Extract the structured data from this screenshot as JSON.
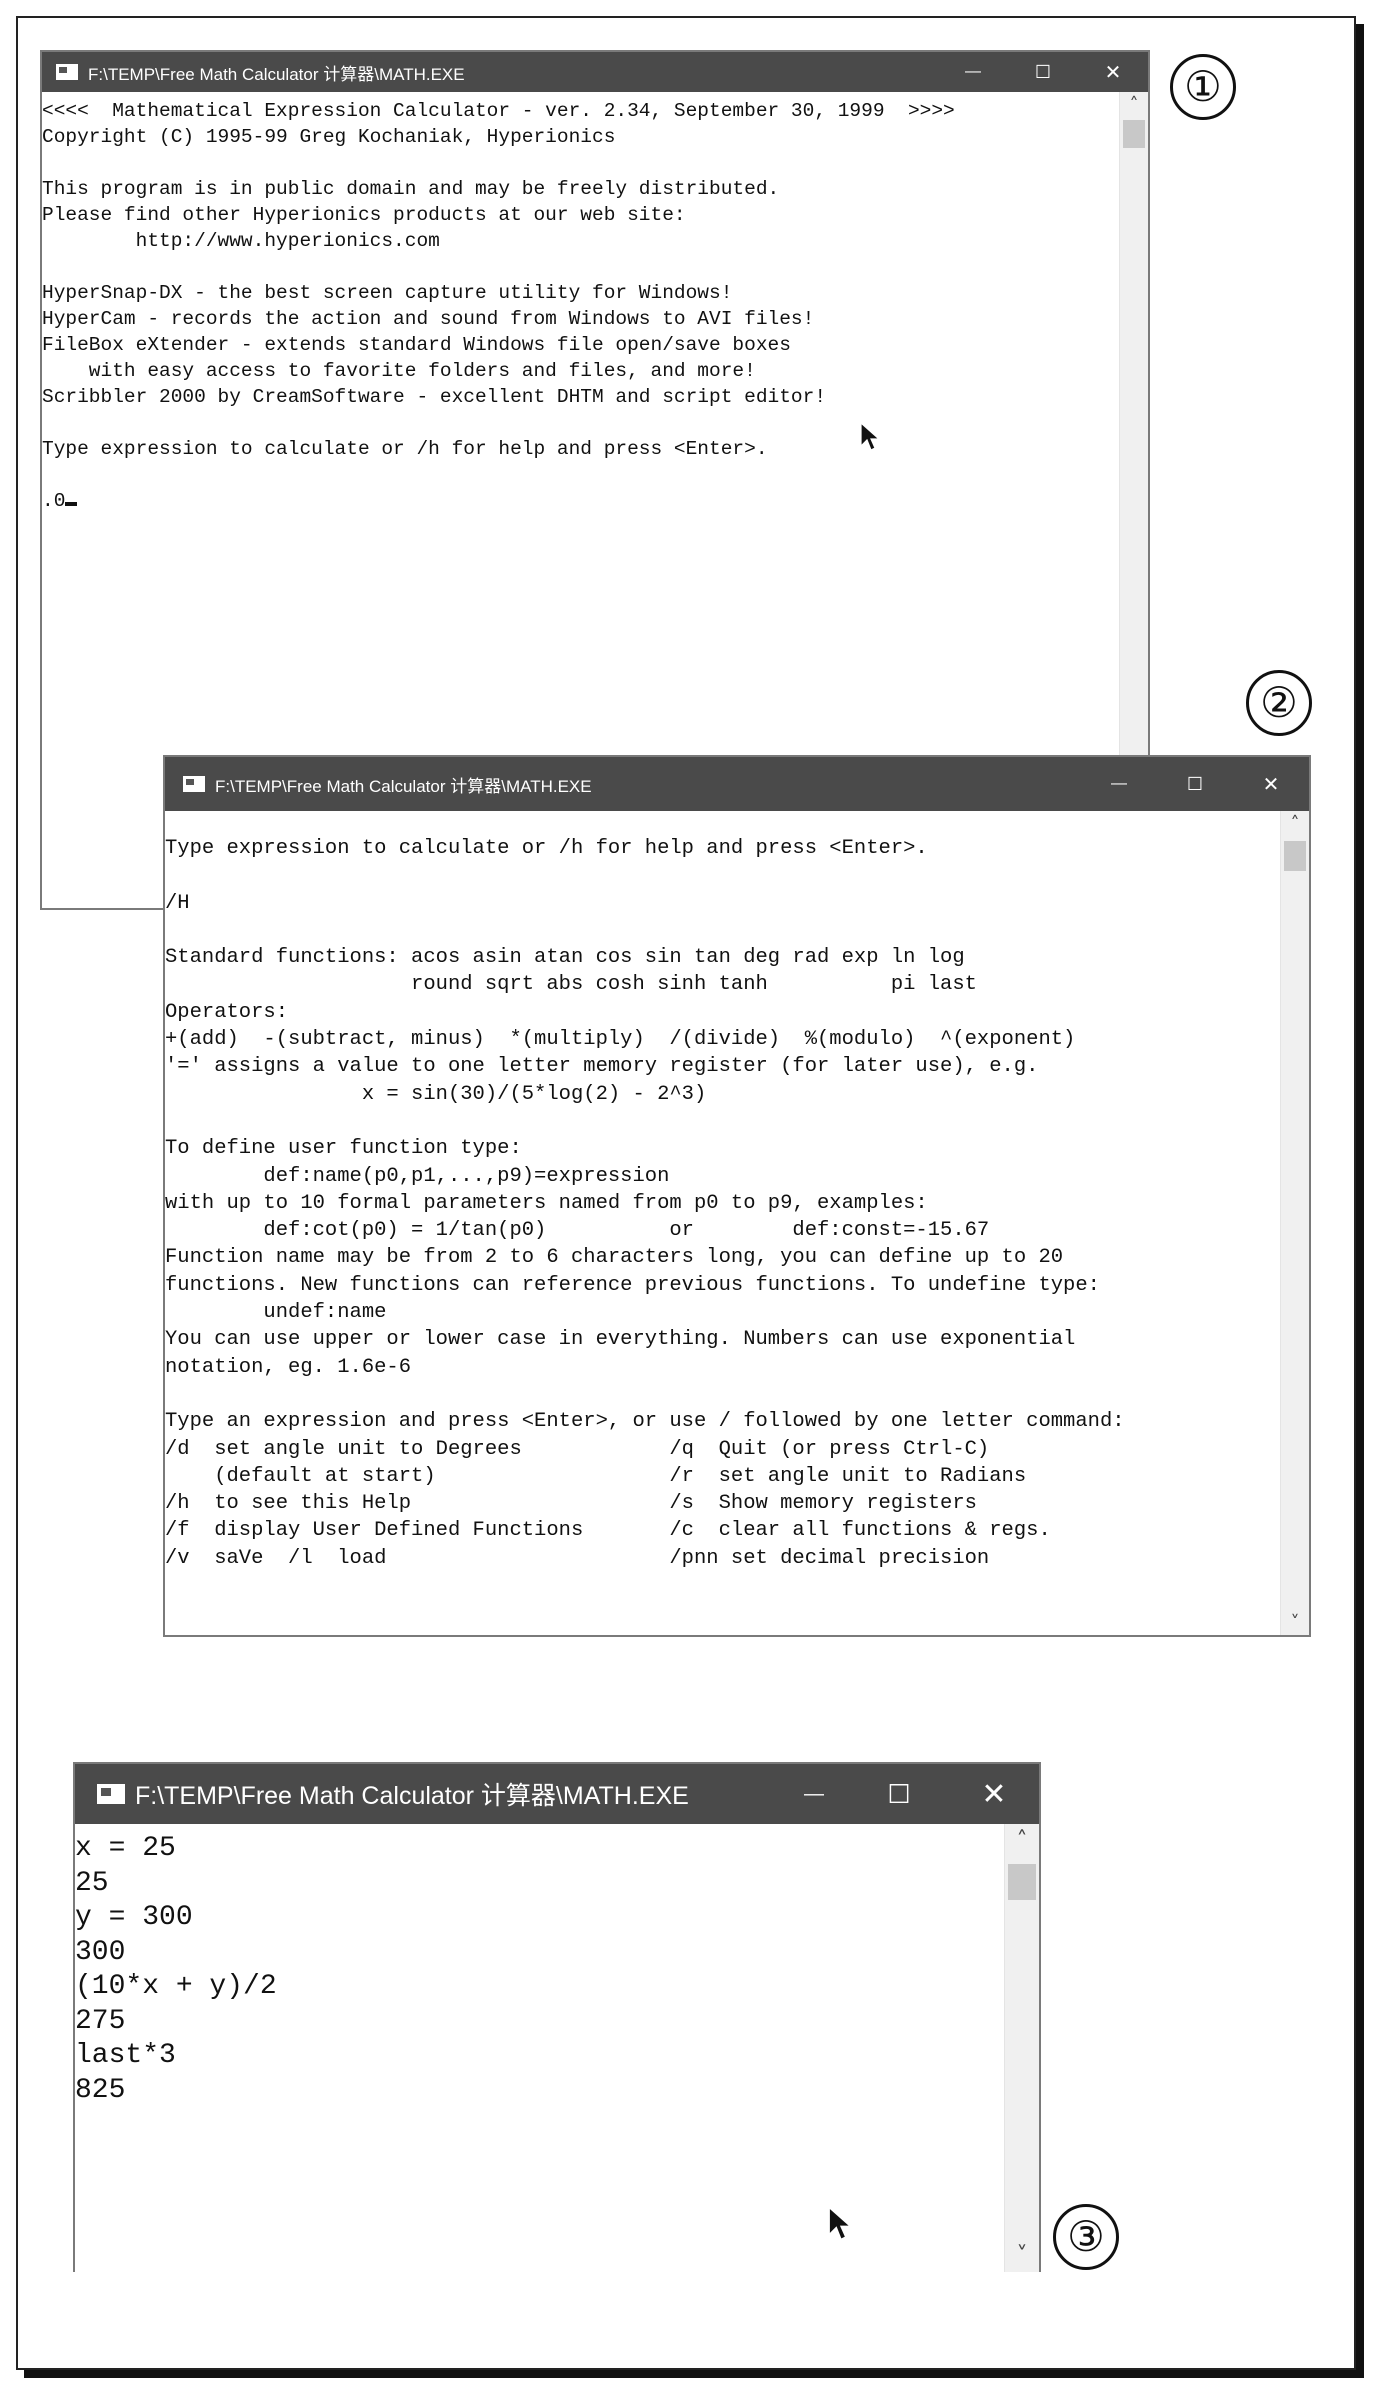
{
  "callouts": [
    "①",
    "②",
    "③"
  ],
  "window1": {
    "title": "F:\\TEMP\\Free Math Calculator 计算器\\MATH.EXE",
    "controls": {
      "minimize": "—",
      "maximize": "☐",
      "close": "✕"
    },
    "lines": [
      "<<<<  Mathematical Expression Calculator - ver. 2.34, September 30, 1999  >>>>",
      "Copyright (C) 1995-99 Greg Kochaniak, Hyperionics",
      "",
      "This program is in public domain and may be freely distributed.",
      "Please find other Hyperionics products at our web site:",
      "        http://www.hyperionics.com",
      "",
      "HyperSnap-DX - the best screen capture utility for Windows!",
      "HyperCam - records the action and sound from Windows to AVI files!",
      "FileBox eXtender - extends standard Windows file open/save boxes",
      "    with easy access to favorite folders and files, and more!",
      "Scribbler 2000 by CreamSoftware - excellent DHTM and script editor!",
      "",
      "Type expression to calculate or /h for help and press <Enter>.",
      ""
    ],
    "prompt": ".0"
  },
  "window2": {
    "title": "F:\\TEMP\\Free Math Calculator 计算器\\MATH.EXE",
    "controls": {
      "minimize": "—",
      "maximize": "☐",
      "close": "✕"
    },
    "lines": [
      "Type expression to calculate or /h for help and press <Enter>.",
      "",
      "/H",
      "",
      "Standard functions: acos asin atan cos sin tan deg rad exp ln log",
      "                    round sqrt abs cosh sinh tanh          pi last",
      "Operators:",
      "+(add)  -(subtract, minus)  *(multiply)  /(divide)  %(modulo)  ^(exponent)",
      "'=' assigns a value to one letter memory register (for later use), e.g.",
      "                x = sin(30)/(5*log(2) - 2^3)",
      "",
      "To define user function type:",
      "        def:name(p0,p1,...,p9)=expression",
      "with up to 10 formal parameters named from p0 to p9, examples:",
      "        def:cot(p0) = 1/tan(p0)          or        def:const=-15.67",
      "Function name may be from 2 to 6 characters long, you can define up to 20",
      "functions. New functions can reference previous functions. To undefine type:",
      "        undef:name",
      "You can use upper or lower case in everything. Numbers can use exponential",
      "notation, eg. 1.6e-6",
      "",
      "Type an expression and press <Enter>, or use / followed by one letter command:",
      "/d  set angle unit to Degrees            /q  Quit (or press Ctrl-C)",
      "    (default at start)                   /r  set angle unit to Radians",
      "/h  to see this Help                     /s  Show memory registers",
      "/f  display User Defined Functions       /c  clear all functions & regs.",
      "/v  saVe  /l  load                       /pnn set decimal precision"
    ]
  },
  "window3": {
    "title": "F:\\TEMP\\Free Math Calculator 计算器\\MATH.EXE",
    "controls": {
      "minimize": "—",
      "maximize": "☐",
      "close": "✕"
    },
    "lines": [
      "x = 25",
      "25",
      "y = 300",
      "300",
      "(10*x + y)/2",
      "275",
      "last*3",
      "825"
    ]
  },
  "icons": {
    "scroll_up": "˄",
    "scroll_down": "˅"
  }
}
